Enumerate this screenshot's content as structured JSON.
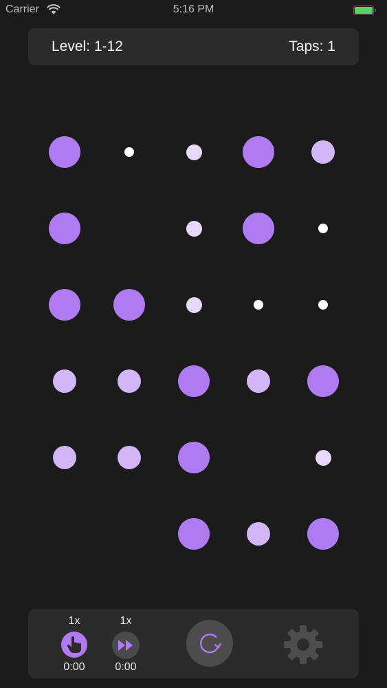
{
  "status_bar": {
    "carrier": "Carrier",
    "time": "5:16 PM"
  },
  "header": {
    "level_text": "Level: 1-12",
    "taps_text": "Taps: 1"
  },
  "board": {
    "columns": 5,
    "rows": 6,
    "colors": {
      "large": "#b07af1",
      "medium": "#d2b6f8",
      "small": "#e6d9fb",
      "tiny": "#ffffff"
    },
    "cells": [
      [
        "large",
        "tiny",
        "small",
        "large",
        "medium"
      ],
      [
        "large",
        "empty",
        "small",
        "large",
        "tiny"
      ],
      [
        "large",
        "large",
        "small",
        "tiny",
        "tiny"
      ],
      [
        "medium",
        "medium",
        "large",
        "medium",
        "large"
      ],
      [
        "medium",
        "medium",
        "large",
        "empty",
        "small"
      ],
      [
        "empty",
        "empty",
        "large",
        "medium",
        "large"
      ]
    ]
  },
  "controls": {
    "tap": {
      "multiplier": "1x",
      "time": "0:00",
      "icon": "hand-pointer-icon"
    },
    "fast_forward": {
      "multiplier": "1x",
      "time": "0:00",
      "icon": "fast-forward-icon"
    },
    "restart": {
      "icon": "restart-icon"
    },
    "settings": {
      "icon": "gear-icon"
    }
  },
  "colors": {
    "background": "#1c1b1c",
    "panel": "#2c2b2c",
    "accent": "#b27af2",
    "battery": "#4cd964"
  }
}
